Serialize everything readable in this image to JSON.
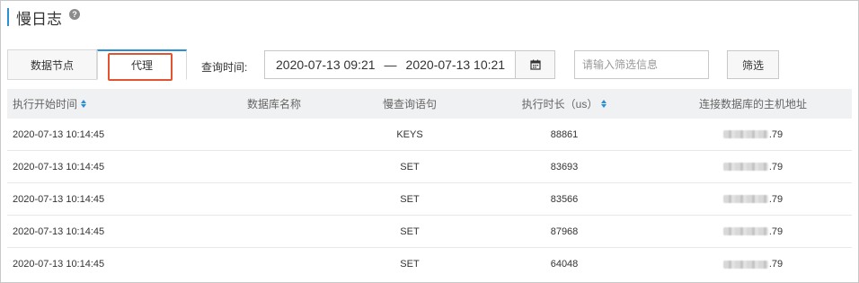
{
  "page": {
    "title": "慢日志",
    "help_icon": "question-circle-icon"
  },
  "tabs": [
    {
      "label": "数据节点",
      "active": false
    },
    {
      "label": "代理",
      "active": true
    }
  ],
  "query": {
    "label": "查询时间:",
    "start": "2020-07-13 09:21",
    "separator": "—",
    "end": "2020-07-13 10:21",
    "calendar_icon": "calendar-icon"
  },
  "filter": {
    "placeholder": "请输入筛选信息",
    "button_label": "筛选"
  },
  "table": {
    "columns": [
      "执行开始时间",
      "数据库名称",
      "慢查询语句",
      "执行时长（us）",
      "连接数据库的主机地址"
    ],
    "rows": [
      {
        "start_time": "2020-07-13 10:14:45",
        "db_name": "",
        "statement": "KEYS",
        "duration": "88861",
        "host_suffix": ".79"
      },
      {
        "start_time": "2020-07-13 10:14:45",
        "db_name": "",
        "statement": "SET",
        "duration": "83693",
        "host_suffix": ".79"
      },
      {
        "start_time": "2020-07-13 10:14:45",
        "db_name": "",
        "statement": "SET",
        "duration": "83566",
        "host_suffix": ".79"
      },
      {
        "start_time": "2020-07-13 10:14:45",
        "db_name": "",
        "statement": "SET",
        "duration": "87968",
        "host_suffix": ".79"
      },
      {
        "start_time": "2020-07-13 10:14:45",
        "db_name": "",
        "statement": "SET",
        "duration": "64048",
        "host_suffix": ".79"
      }
    ]
  },
  "colors": {
    "accent": "#2b8fd6",
    "highlight_box": "#e2532f",
    "header_bg": "#f0f1f3"
  }
}
